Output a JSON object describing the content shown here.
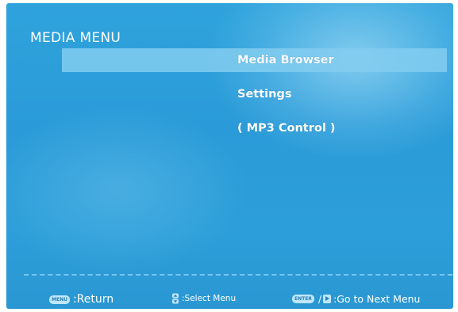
{
  "screen": {
    "title": "MEDIA MENU"
  },
  "menu": {
    "items": [
      {
        "label": "Media Browser",
        "selected": true
      },
      {
        "label": "Settings",
        "selected": false
      },
      {
        "label": "( MP3 Control )",
        "selected": false
      }
    ]
  },
  "footer": {
    "return_key": "MENU",
    "return_label": ":Return",
    "select_icon": "up-down-icon",
    "select_label": ":Select Menu",
    "next_key": "ENTER",
    "next_separator": "/",
    "next_icon": "right-arrow-icon",
    "next_label": ":Go to Next Menu"
  },
  "colors": {
    "background": "#2ca0da",
    "highlight": "#82cdf0",
    "text": "#ffffff"
  }
}
